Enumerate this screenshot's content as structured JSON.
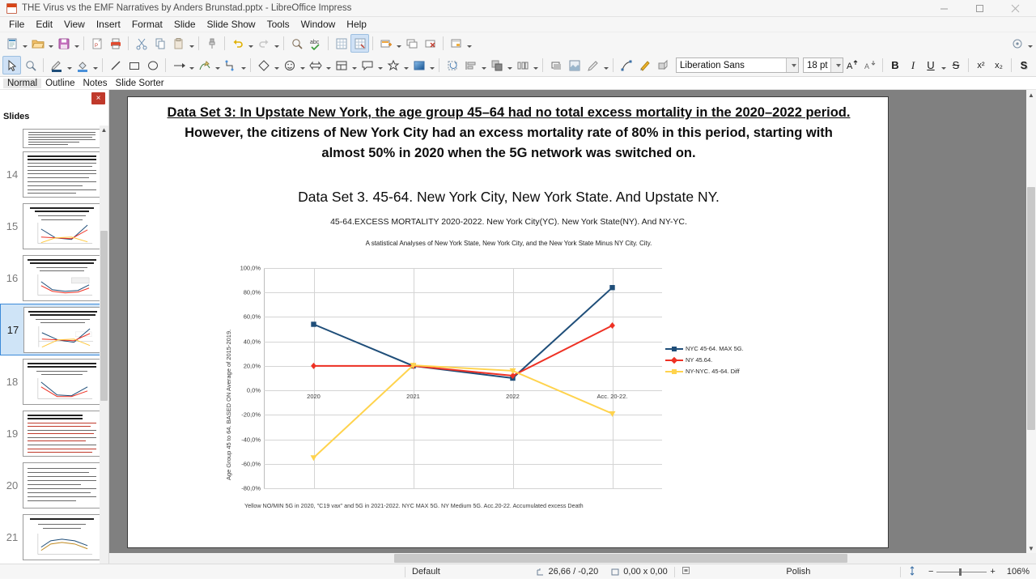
{
  "window": {
    "title": "THE Virus vs the EMF Narratives by Anders Brunstad.pptx - LibreOffice Impress",
    "minimize": "─",
    "maximize": "□",
    "close": "✕"
  },
  "menu": [
    "File",
    "Edit",
    "View",
    "Insert",
    "Format",
    "Slide",
    "Slide Show",
    "Tools",
    "Window",
    "Help"
  ],
  "formatbar": {
    "font_name": "Liberation Sans",
    "font_size": "18 pt",
    "bold": "B",
    "italic": "I",
    "underline": "U",
    "strikethrough": "S",
    "superscript": "x²",
    "subscript": "x₂",
    "shadow": "S",
    "outline": "A",
    "clear": "A",
    "fontcolor": "A",
    "grow": "A",
    "shrink": "A",
    "overflow": "»"
  },
  "viewtabs": [
    {
      "label": "Normal",
      "selected": true
    },
    {
      "label": "Outline",
      "selected": false
    },
    {
      "label": "Notes",
      "selected": false
    },
    {
      "label": "Slide Sorter",
      "selected": false
    }
  ],
  "slidepanel": {
    "title": "Slides",
    "close_label": "×",
    "slides": [
      {
        "number": "",
        "type": "text",
        "selected": false
      },
      {
        "number": "14",
        "type": "text",
        "selected": false
      },
      {
        "number": "15",
        "type": "chart",
        "selected": false
      },
      {
        "number": "16",
        "type": "chart",
        "selected": false
      },
      {
        "number": "17",
        "type": "chart",
        "selected": true
      },
      {
        "number": "18",
        "type": "chart",
        "selected": false
      },
      {
        "number": "19",
        "type": "text-red",
        "selected": false
      },
      {
        "number": "20",
        "type": "text",
        "selected": false
      },
      {
        "number": "21",
        "type": "chart",
        "selected": false
      }
    ]
  },
  "slide": {
    "title_underlined": "Data Set 3: In Upstate New York, the age group 45–64 had no total excess mortality in the 2020–2022 period.",
    "title_rest": "However, the citizens of New York City had an excess mortality rate of 80% in this period, starting with almost 50% in 2020 when the 5G network was switched on.",
    "subtitle": "Data Set 3. 45-64. New York City, New York State. And Upstate NY.",
    "chart_heading": "45-64.EXCESS MORTALITY 2020-2022. New York City(YC). New York State(NY).  And NY-YC.",
    "chart_subheading": "A statistical Analyses of New York State, New York City, and the New York State Minus NY City. City.",
    "footnote": "Yellow NO/MIN 5G in 2020, \"C19 vax\" and 5G in 2021-2022. NYC MAX 5G. NY Medium 5G. Acc.20-22. Accumulated excess Death"
  },
  "chart_data": {
    "type": "line",
    "title": "45-64.EXCESS MORTALITY 2020-2022. New York City(YC). New York State(NY).  And NY-YC.",
    "subtitle": "A statistical Analyses of New York State, New York City, and the New York State Minus NY City. City.",
    "xlabel": "",
    "ylabel": "Age Group 45 to 64. BASED ON Average of 2015-2019.",
    "categories": [
      "2020",
      "2021",
      "2022",
      "Acc. 20-22."
    ],
    "ylim": [
      -80,
      100
    ],
    "ytick_labels": [
      "100,0%",
      "80,0%",
      "60,0%",
      "40,0%",
      "20,0%",
      "0,0%",
      "-20,0%",
      "-40,0%",
      "-60,0%",
      "-80,0%"
    ],
    "ytick_values": [
      100,
      80,
      60,
      40,
      20,
      0,
      -20,
      -40,
      -60,
      -80
    ],
    "grid": true,
    "legend_position": "right",
    "series": [
      {
        "name": "NYC 45-64. MAX 5G.",
        "color": "#1f4e79",
        "marker": "square",
        "values": [
          54,
          20,
          10,
          84
        ]
      },
      {
        "name": "NY 45.64.",
        "color": "#ee3124",
        "marker": "diamond",
        "values": [
          20,
          20,
          12,
          53
        ]
      },
      {
        "name": "NY-NYC. 45-64. Diff",
        "color": "#ffd34d",
        "marker": "triangle",
        "values": [
          -55,
          20.5,
          16,
          -19
        ]
      }
    ]
  },
  "statusbar": {
    "layout": "Default",
    "position": "26,66 / -0,20",
    "size": "0,00 x 0,00",
    "language": "Polish",
    "zoom": "106%",
    "zoom_out": "−",
    "zoom_in": "+"
  }
}
